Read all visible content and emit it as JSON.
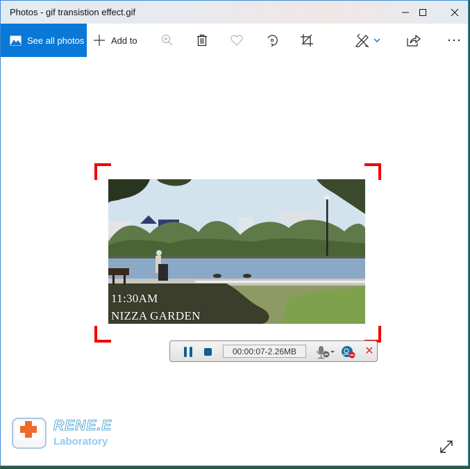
{
  "window": {
    "title": "Photos - gif transistion effect.gif",
    "controls": {
      "minimize": "minimize-icon",
      "maximize": "maximize-icon",
      "close": "close-icon"
    }
  },
  "toolbar": {
    "see_all_photos": {
      "label": "See all photos",
      "icon": "photos-icon"
    },
    "add_to": {
      "label": "Add to",
      "icon": "plus-icon"
    },
    "buttons": [
      {
        "name": "zoom",
        "icon": "zoom-in-icon",
        "enabled": false
      },
      {
        "name": "delete",
        "icon": "trash-icon",
        "enabled": true
      },
      {
        "name": "favorite",
        "icon": "heart-icon",
        "enabled": false
      },
      {
        "name": "rotate",
        "icon": "rotate-icon",
        "enabled": true
      },
      {
        "name": "crop",
        "icon": "crop-icon",
        "enabled": true
      },
      {
        "name": "edit-create",
        "icon": "edit-create-icon",
        "enabled": true
      },
      {
        "name": "share",
        "icon": "share-icon",
        "enabled": true
      },
      {
        "name": "more",
        "icon": "more-icon",
        "enabled": true
      }
    ],
    "accent_color": "#0a78d7"
  },
  "photo": {
    "caption_time": "11:30AM",
    "caption_place": "NIZZA GARDEN",
    "selection_color": "#f20000"
  },
  "recorder": {
    "elapsed_size": "00:00:07-2.26MB",
    "controls": [
      "pause-icon",
      "stop-icon",
      "microphone-icon",
      "webcam-icon",
      "close-icon"
    ],
    "accent_color": "#0f5f8f"
  },
  "watermark": {
    "brand": "RENE.E",
    "subtitle": "Laboratory"
  },
  "viewer": {
    "fullscreen_icon": "expand-icon"
  }
}
